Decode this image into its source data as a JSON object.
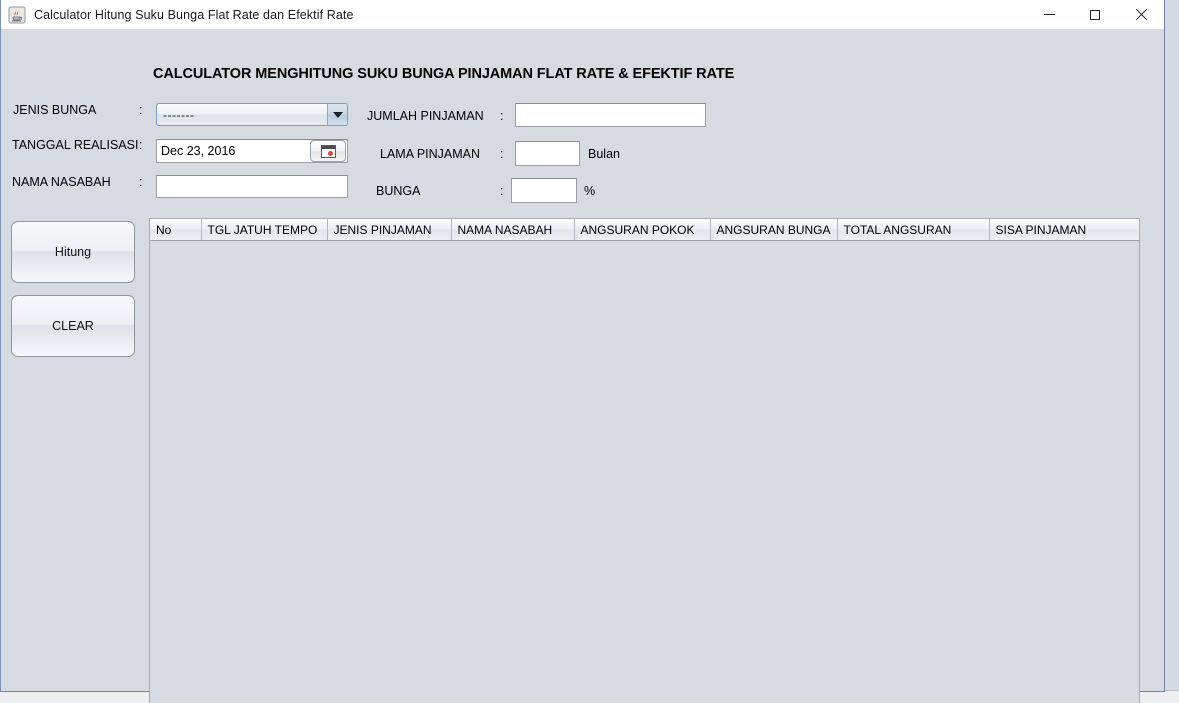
{
  "window": {
    "title": "Calculator Hitung Suku Bunga Flat Rate dan Efektif Rate",
    "icon": "java-coffee-cup-icon",
    "controls": {
      "minimize": "minimize-icon",
      "maximize": "maximize-icon",
      "close": "close-icon"
    }
  },
  "heading": "CALCULATOR MENGHITUNG SUKU BUNGA PINJAMAN FLAT RATE & EFEKTIF RATE",
  "form": {
    "colon": ":",
    "left": {
      "jenis_bunga": {
        "label": "JENIS BUNGA",
        "value": "-------",
        "arrow_icon": "chevron-down-icon"
      },
      "tanggal_realisasi": {
        "label": "TANGGAL REALISASI",
        "value": "Dec 23, 2016",
        "picker_icon": "calendar-icon"
      },
      "nama_nasabah": {
        "label": "NAMA NASABAH",
        "value": "",
        "placeholder": ""
      }
    },
    "right": {
      "jumlah_pinjaman": {
        "label": "JUMLAH PINJAMAN",
        "value": "",
        "placeholder": ""
      },
      "lama_pinjaman": {
        "label": "LAMA PINJAMAN",
        "value": "",
        "placeholder": "",
        "unit": "Bulan"
      },
      "bunga": {
        "label": "BUNGA",
        "value": "",
        "placeholder": "",
        "unit": "%"
      }
    }
  },
  "buttons": {
    "hitung": "Hitung",
    "clear": "CLEAR"
  },
  "table": {
    "columns": [
      "No",
      "TGL JATUH TEMPO",
      "JENIS PINJAMAN",
      "NAMA NASABAH",
      "ANGSURAN POKOK",
      "ANGSURAN BUNGA",
      "TOTAL ANGSURAN",
      "SISA PINJAMAN"
    ],
    "rows": []
  },
  "colors": {
    "panel": "#d6dae1",
    "titlebar": "#ffffff",
    "field": "#ffffff",
    "border": "#9a9fa6",
    "combo_border": "#7a9ec4",
    "window_border": "#6f87a6"
  }
}
